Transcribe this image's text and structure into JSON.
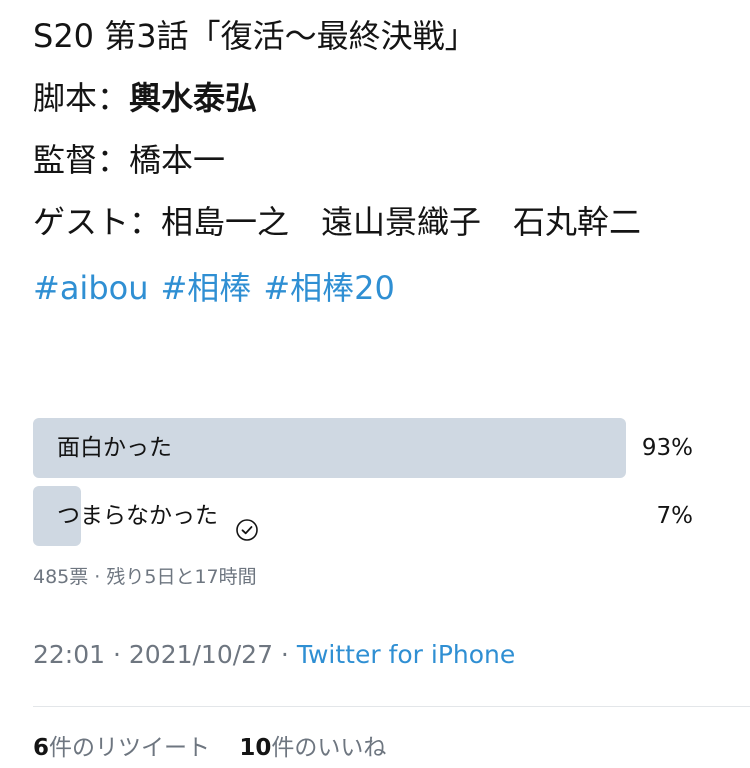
{
  "tweet": {
    "title": "S20 第3話「復活〜最終決戦」",
    "writer_label": "脚本：",
    "writer_name": "輿水泰弘",
    "director_label": "監督：",
    "director_name": "橋本一",
    "guest_label": "ゲスト：",
    "guest_names": "相島一之　遠山景織子　石丸幹二",
    "hashtags": [
      "#aibou",
      "#相棒",
      "#相棒20"
    ]
  },
  "poll": {
    "options": [
      {
        "label": "面白かった",
        "percent_text": "93%",
        "percent": 93,
        "voted": false
      },
      {
        "label": "つまらなかった",
        "percent_text": "7%",
        "percent": 7,
        "voted": true
      }
    ],
    "check_icon": "check-circle-icon",
    "votes_remaining": "485票 · 残り5日と17時間"
  },
  "timestamp": {
    "time_date": "22:01 · 2021/10/27 · ",
    "source": "Twitter for iPhone"
  },
  "engagement": {
    "retweets_count": "6",
    "retweets_label": "件のリツイート",
    "likes_count": "10",
    "likes_label": "件のいいね"
  },
  "colors": {
    "link": "#2f8fd3",
    "poll_bar": "#cfd8e2",
    "muted_text": "#6e7680"
  }
}
